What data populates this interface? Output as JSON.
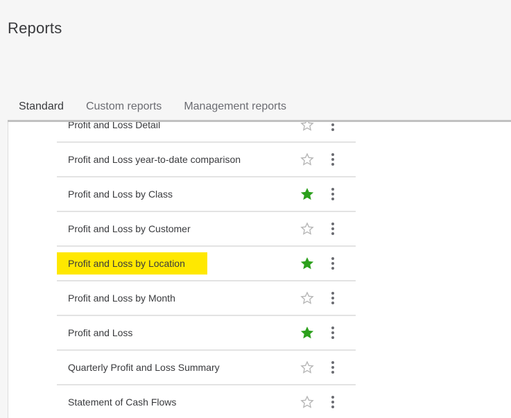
{
  "header": {
    "title": "Reports"
  },
  "tabs": [
    {
      "label": "Standard",
      "active": true
    },
    {
      "label": "Custom reports",
      "active": false
    },
    {
      "label": "Management reports",
      "active": false
    }
  ],
  "colors": {
    "accent_green": "#2ca01c",
    "highlight_yellow": "#ffe800",
    "star_outline": "#b5b5b5",
    "text": "#393a3d"
  },
  "reports": [
    {
      "name": "Profit and Loss Detail",
      "favorite": false,
      "highlighted": false,
      "clipped": true
    },
    {
      "name": "Profit and Loss year-to-date comparison",
      "favorite": false,
      "highlighted": false
    },
    {
      "name": "Profit and Loss by Class",
      "favorite": true,
      "highlighted": false
    },
    {
      "name": "Profit and Loss by Customer",
      "favorite": false,
      "highlighted": false
    },
    {
      "name": "Profit and Loss by Location",
      "favorite": true,
      "highlighted": true
    },
    {
      "name": "Profit and Loss by Month",
      "favorite": false,
      "highlighted": false
    },
    {
      "name": "Profit and Loss",
      "favorite": true,
      "highlighted": false
    },
    {
      "name": "Quarterly Profit and Loss Summary",
      "favorite": false,
      "highlighted": false
    },
    {
      "name": "Statement of Cash Flows",
      "favorite": false,
      "highlighted": false
    }
  ],
  "icons": {
    "favorite_on": "star-filled-icon",
    "favorite_off": "star-outline-icon",
    "more": "kebab-menu-icon"
  }
}
